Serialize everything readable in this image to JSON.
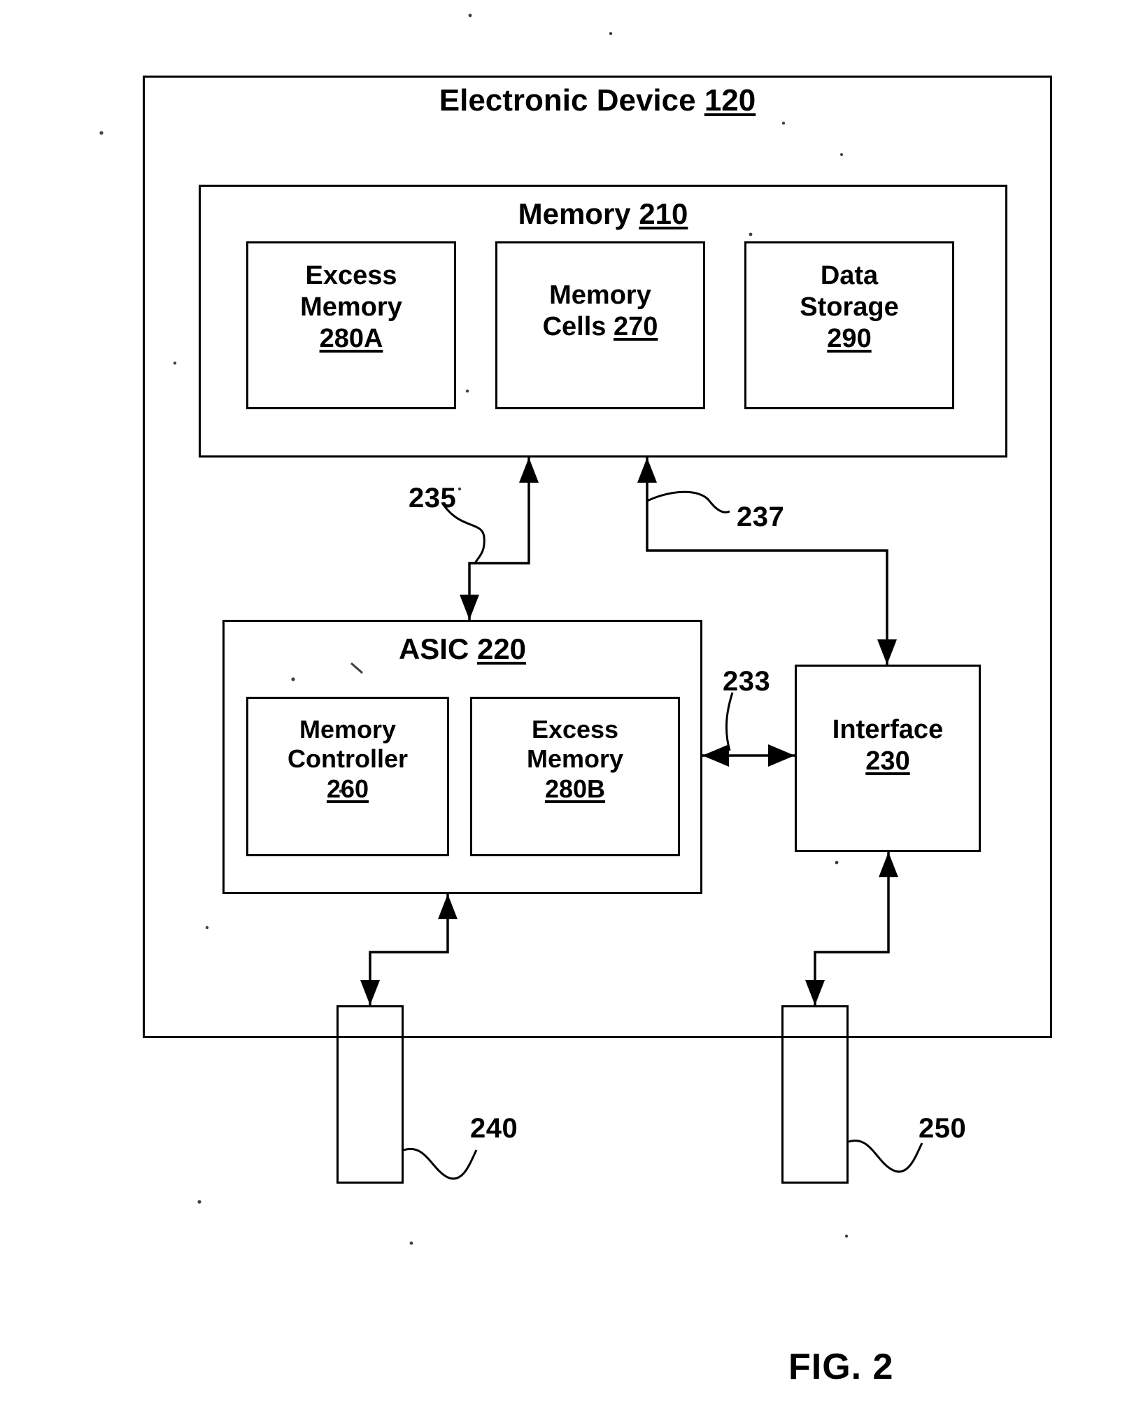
{
  "figure": {
    "caption": "FIG. 2"
  },
  "device": {
    "title_text": "Electronic Device ",
    "title_ref": "120"
  },
  "memory": {
    "title_text": "Memory ",
    "title_ref": "210",
    "blocks": [
      {
        "name": "excess-memory-a",
        "line1": "Excess",
        "line2": "Memory",
        "ref": "280A"
      },
      {
        "name": "memory-cells",
        "line1": "Memory",
        "line2": "Cells ",
        "ref": "270",
        "inline_ref": true
      },
      {
        "name": "data-storage",
        "line1": "Data",
        "line2": "Storage",
        "ref": "290"
      }
    ]
  },
  "asic": {
    "title_text": "ASIC ",
    "title_ref": "220",
    "blocks": [
      {
        "name": "memory-controller",
        "line1": "Memory",
        "line2": "Controller",
        "ref": "260"
      },
      {
        "name": "excess-memory-b",
        "line1": "Excess",
        "line2": "Memory",
        "ref": "280B"
      }
    ]
  },
  "interface": {
    "line1": "Interface",
    "ref": "230"
  },
  "connectors": [
    {
      "name": "memory-to-asic-bus",
      "ref": "235"
    },
    {
      "name": "memory-to-interface-bus",
      "ref": "237"
    },
    {
      "name": "asic-to-interface-bus",
      "ref": "233"
    }
  ],
  "ports": [
    {
      "name": "port-lower-left",
      "ref": "240"
    },
    {
      "name": "port-lower-right",
      "ref": "250"
    }
  ],
  "colors": {
    "line": "#000000",
    "background": "#ffffff"
  }
}
